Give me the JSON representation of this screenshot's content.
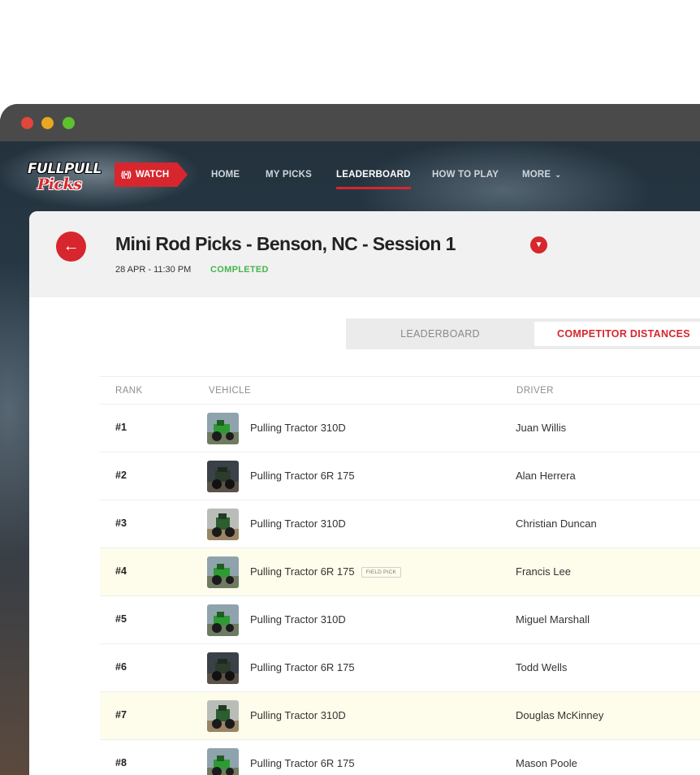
{
  "nav": {
    "logo_line1": "FULLPULL",
    "logo_line2": "Picks",
    "watch_label": "WATCH",
    "links": [
      "HOME",
      "MY PICKS",
      "LEADERBOARD",
      "HOW TO PLAY",
      "MORE"
    ],
    "active": "LEADERBOARD"
  },
  "header": {
    "title": "Mini Rod Picks - Benson, NC - Session 1",
    "date": "28 APR - 11:30 PM",
    "status": "COMPLETED"
  },
  "tabs": {
    "leaderboard": "LEADERBOARD",
    "competitor_distances": "COMPETITOR DISTANCES",
    "selected": "COMPETITOR DISTANCES"
  },
  "table": {
    "headers": {
      "rank": "RANK",
      "vehicle": "VEHICLE",
      "driver": "DRIVER"
    },
    "rows": [
      {
        "rank": "#1",
        "vehicle": "Pulling Tractor 310D",
        "driver": "Juan Willis",
        "badge": "",
        "highlight": false,
        "thumb": "green"
      },
      {
        "rank": "#2",
        "vehicle": "Pulling Tractor 6R 175",
        "driver": "Alan Herrera",
        "badge": "",
        "highlight": false,
        "thumb": "dark"
      },
      {
        "rank": "#3",
        "vehicle": "Pulling Tractor 310D",
        "driver": "Christian Duncan",
        "badge": "",
        "highlight": false,
        "thumb": "dirt"
      },
      {
        "rank": "#4",
        "vehicle": "Pulling Tractor 6R 175",
        "driver": "Francis Lee",
        "badge": "FIELD PICK",
        "highlight": true,
        "thumb": "green"
      },
      {
        "rank": "#5",
        "vehicle": "Pulling Tractor 310D",
        "driver": "Miguel Marshall",
        "badge": "",
        "highlight": false,
        "thumb": "green"
      },
      {
        "rank": "#6",
        "vehicle": "Pulling Tractor 6R 175",
        "driver": "Todd Wells",
        "badge": "",
        "highlight": false,
        "thumb": "dark"
      },
      {
        "rank": "#7",
        "vehicle": "Pulling Tractor 310D",
        "driver": "Douglas McKinney",
        "badge": "",
        "highlight": true,
        "thumb": "dirt"
      },
      {
        "rank": "#8",
        "vehicle": "Pulling Tractor 6R 175",
        "driver": "Mason Poole",
        "badge": "",
        "highlight": false,
        "thumb": "green"
      }
    ]
  },
  "colors": {
    "accent": "#d7262d",
    "status_green": "#46b44b",
    "highlight_row": "#fefdeb"
  },
  "icons": {
    "back": "arrow-left-icon",
    "watch": "broadcast-icon",
    "title_dropdown": "chevron-down-icon",
    "more": "chevron-down-icon"
  }
}
